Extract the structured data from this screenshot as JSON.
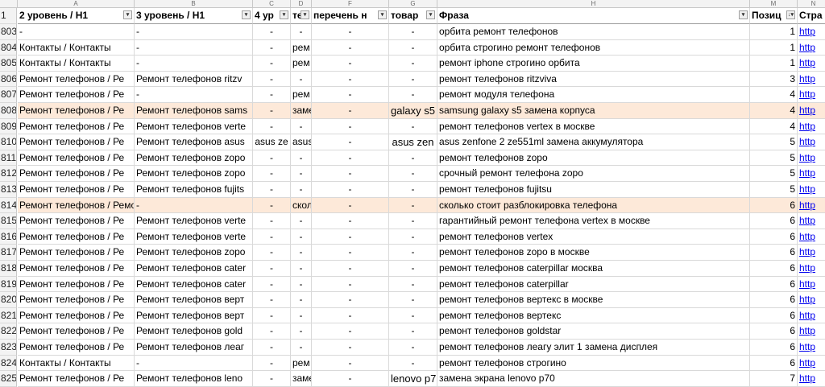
{
  "col_letters": [
    "A",
    "B",
    "C",
    "D",
    "F",
    "G",
    "H",
    "M",
    "N"
  ],
  "header": {
    "row_num": "1",
    "cells": [
      "2 уровень / H1",
      "3 уровень / H1",
      "4 ур",
      "те",
      "перечень н",
      "товар",
      "Фраза",
      "Позиц",
      "Стра"
    ],
    "filter_glyphs": [
      "▾",
      "▾",
      "▾",
      "▾",
      "▾",
      "▾",
      "▾",
      "↓▾",
      ""
    ]
  },
  "rows": [
    {
      "num": "803",
      "cells": [
        "-",
        "-",
        "-",
        "-",
        "-",
        "-",
        "орбита ремонт телефонов",
        "1",
        "http"
      ],
      "hl": false
    },
    {
      "num": "804",
      "cells": [
        "Контакты / Контакты",
        "-",
        "-",
        "рем",
        "-",
        "-",
        "орбита строгино ремонт телефонов",
        "1",
        "http"
      ],
      "hl": false
    },
    {
      "num": "805",
      "cells": [
        "Контакты / Контакты",
        "-",
        "-",
        "рем",
        "-",
        "-",
        "ремонт iphone строгино орбита",
        "1",
        "http"
      ],
      "hl": false
    },
    {
      "num": "806",
      "cells": [
        "Ремонт телефонов / Ре",
        "Ремонт телефонов ritzv",
        "-",
        "-",
        "-",
        "-",
        "ремонт телефонов ritzviva",
        "3",
        "http"
      ],
      "hl": false
    },
    {
      "num": "807",
      "cells": [
        "Ремонт телефонов / Ре",
        "-",
        "-",
        "рем",
        "-",
        "-",
        "ремонт модуля телефона",
        "4",
        "http"
      ],
      "hl": false
    },
    {
      "num": "808",
      "cells": [
        "Ремонт телефонов / Ре",
        "Ремонт телефонов sams",
        "-",
        "заме",
        "-",
        "galaxy s5",
        "samsung galaxy s5 замена корпуса",
        "4",
        "http"
      ],
      "hl": true
    },
    {
      "num": "809",
      "cells": [
        "Ремонт телефонов / Ре",
        "Ремонт телефонов verte",
        "-",
        "-",
        "-",
        "-",
        "ремонт телефонов vertex в москве",
        "4",
        "http"
      ],
      "hl": false
    },
    {
      "num": "810",
      "cells": [
        "Ремонт телефонов / Ре",
        "Ремонт телефонов asus",
        "asus ze",
        "asus",
        "-",
        "asus zen",
        "asus zenfone 2 ze551ml замена аккумулятора",
        "5",
        "http"
      ],
      "hl": false
    },
    {
      "num": "811",
      "cells": [
        "Ремонт телефонов / Ре",
        "Ремонт телефонов zopo",
        "-",
        "-",
        "-",
        "-",
        "ремонт телефонов zopo",
        "5",
        "http"
      ],
      "hl": false
    },
    {
      "num": "812",
      "cells": [
        "Ремонт телефонов / Ре",
        "Ремонт телефонов zopo",
        "-",
        "-",
        "-",
        "-",
        "срочный ремонт телефона zopo",
        "5",
        "http"
      ],
      "hl": false
    },
    {
      "num": "813",
      "cells": [
        "Ремонт телефонов / Ре",
        "Ремонт телефонов fujits",
        "-",
        "-",
        "-",
        "-",
        "ремонт телефонов fujitsu",
        "5",
        "http"
      ],
      "hl": false
    },
    {
      "num": "814",
      "cells": [
        "Ремонт телефонов / Ремо",
        "-",
        "-",
        "сколь",
        "-",
        "-",
        "сколько стоит разблокировка телефона",
        "6",
        "http"
      ],
      "hl": true
    },
    {
      "num": "815",
      "cells": [
        "Ремонт телефонов / Ре",
        "Ремонт телефонов verte",
        "-",
        "-",
        "-",
        "-",
        "гарантийный ремонт телефона vertex в москве",
        "6",
        "http"
      ],
      "hl": false
    },
    {
      "num": "816",
      "cells": [
        "Ремонт телефонов / Ре",
        "Ремонт телефонов verte",
        "-",
        "-",
        "-",
        "-",
        "ремонт телефонов vertex",
        "6",
        "http"
      ],
      "hl": false
    },
    {
      "num": "817",
      "cells": [
        "Ремонт телефонов / Ре",
        "Ремонт телефонов zopo",
        "-",
        "-",
        "-",
        "-",
        "ремонт телефонов zopo в москве",
        "6",
        "http"
      ],
      "hl": false
    },
    {
      "num": "818",
      "cells": [
        "Ремонт телефонов / Ре",
        "Ремонт телефонов cater",
        "-",
        "-",
        "-",
        "-",
        "ремонт телефонов caterpillar москва",
        "6",
        "http"
      ],
      "hl": false
    },
    {
      "num": "819",
      "cells": [
        "Ремонт телефонов / Ре",
        "Ремонт телефонов cater",
        "-",
        "-",
        "-",
        "-",
        "ремонт телефонов caterpillar",
        "6",
        "http"
      ],
      "hl": false
    },
    {
      "num": "820",
      "cells": [
        "Ремонт телефонов / Ре",
        "Ремонт телефонов верт",
        "-",
        "-",
        "-",
        "-",
        "ремонт телефонов вертекс в москве",
        "6",
        "http"
      ],
      "hl": false
    },
    {
      "num": "821",
      "cells": [
        "Ремонт телефонов / Ре",
        "Ремонт телефонов верт",
        "-",
        "-",
        "-",
        "-",
        "ремонт телефонов вертекс",
        "6",
        "http"
      ],
      "hl": false
    },
    {
      "num": "822",
      "cells": [
        "Ремонт телефонов / Ре",
        "Ремонт телефонов gold",
        "-",
        "-",
        "-",
        "-",
        "ремонт телефонов goldstar",
        "6",
        "http"
      ],
      "hl": false
    },
    {
      "num": "823",
      "cells": [
        "Ремонт телефонов / Ре",
        "Ремонт телефонов леаг",
        "-",
        "-",
        "-",
        "-",
        "ремонт телефонов леагу элит 1 замена дисплея",
        "6",
        "http"
      ],
      "hl": false
    },
    {
      "num": "824",
      "cells": [
        "Контакты / Контакты",
        "-",
        "-",
        "рем",
        "-",
        "-",
        "ремонт телефонов строгино",
        "6",
        "http"
      ],
      "hl": false
    },
    {
      "num": "825",
      "cells": [
        "Ремонт телефонов / Ре",
        "Ремонт телефонов leno",
        "-",
        "заме",
        "-",
        "lenovo p7",
        "замена экрана lenovo p70",
        "7",
        "http"
      ],
      "hl": false
    }
  ],
  "colors": {
    "highlight": "#fde9d9",
    "grid": "#d9d9d9",
    "header_bg": "#f3f3f3",
    "link": "#0000ee"
  }
}
